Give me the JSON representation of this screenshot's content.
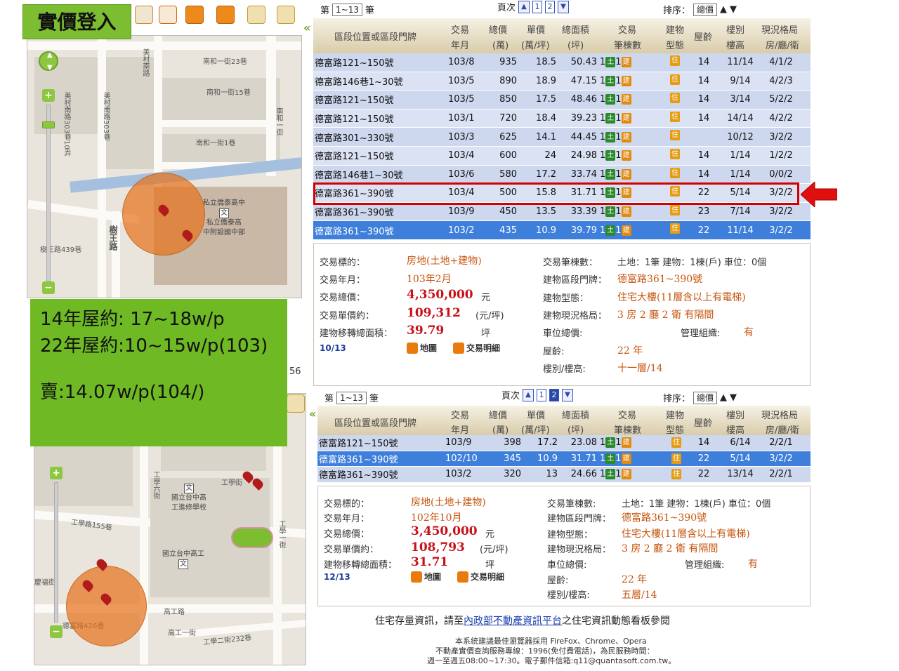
{
  "title": "實價登入",
  "note": {
    "line1": "14年屋約: 17~18w/p",
    "line2": "22年屋約:10~15w/p(103)",
    "line3": "賣:14.07w/p(104/)"
  },
  "colors": {
    "accent_green": "#7cbd31",
    "selected_row": "#3d7fdb",
    "highlight": "#d40000",
    "price_red": "#c8101a"
  },
  "map_top": {
    "streets": [
      "南和一街23巷",
      "南和一街15巷",
      "南和一街1巷",
      "美村南路",
      "美村南路303巷",
      "南和一街",
      "樹王路",
      "樹王路439巷",
      "美村南路303巷10弄"
    ],
    "pois": [
      "私立僑泰高中",
      "私立僑泰高",
      "中附設國中部"
    ]
  },
  "map_bottom": {
    "streets": [
      "工學路155巷",
      "工學二街232巷",
      "工學街",
      "高工路",
      "高工一街",
      "德富路426巷",
      "慶福街",
      "工學六街",
      "工學一街"
    ],
    "pois": [
      "國立台中高",
      "工進修學校",
      "國立台中高工"
    ],
    "scale_partial": "56"
  },
  "top": {
    "pager": {
      "range_label": "第",
      "range": "1~13",
      "unit": "筆",
      "page_label": "頁次",
      "pages": [
        "1",
        "2"
      ]
    },
    "sort": {
      "label": "排序：",
      "value": "總價",
      "asc": "▲",
      "desc": "▼"
    },
    "headers": {
      "location": "區段位置或區段門牌",
      "date1": "交易",
      "date2": "年月",
      "total1": "總價",
      "total2": "(萬)",
      "unit1": "單價",
      "unit2": "(萬/坪)",
      "area1": "總面積",
      "area2": "(坪)",
      "count1": "交易",
      "count2": "筆棟數",
      "type1": "建物",
      "type2": "型態",
      "age": "屋齡",
      "floor1": "樓別",
      "floor2": "樓高",
      "layout1": "現況格局",
      "layout2": "房/廳/衛"
    },
    "rows": [
      {
        "addr": "德富路121~150號",
        "date": "103/8",
        "total": "935",
        "unit": "18.5",
        "area": "50.43",
        "age": "14",
        "floor": "11/14",
        "layout": "4/1/2"
      },
      {
        "addr": "德富路146巷1~30號",
        "date": "103/5",
        "total": "890",
        "unit": "18.9",
        "area": "47.15",
        "age": "14",
        "floor": "9/14",
        "layout": "4/2/3"
      },
      {
        "addr": "德富路121~150號",
        "date": "103/5",
        "total": "850",
        "unit": "17.5",
        "area": "48.46",
        "age": "14",
        "floor": "3/14",
        "layout": "5/2/2"
      },
      {
        "addr": "德富路121~150號",
        "date": "103/1",
        "total": "720",
        "unit": "18.4",
        "area": "39.23",
        "age": "14",
        "floor": "14/14",
        "layout": "4/2/2"
      },
      {
        "addr": "德富路301~330號",
        "date": "103/3",
        "total": "625",
        "unit": "14.1",
        "area": "44.45",
        "age": "",
        "floor": "10/12",
        "layout": "3/2/2"
      },
      {
        "addr": "德富路121~150號",
        "date": "103/4",
        "total": "600",
        "unit": "24",
        "area": "24.98",
        "age": "14",
        "floor": "1/14",
        "layout": "1/2/2"
      },
      {
        "addr": "德富路146巷1~30號",
        "date": "103/6",
        "total": "580",
        "unit": "17.2",
        "area": "33.74",
        "age": "14",
        "floor": "1/14",
        "layout": "0/0/2"
      },
      {
        "addr": "德富路361~390號",
        "date": "103/4",
        "total": "500",
        "unit": "15.8",
        "area": "31.71",
        "age": "22",
        "floor": "5/14",
        "layout": "3/2/2"
      },
      {
        "addr": "德富路361~390號",
        "date": "103/9",
        "total": "450",
        "unit": "13.5",
        "area": "33.39",
        "age": "23",
        "floor": "7/14",
        "layout": "3/2/2"
      },
      {
        "addr": "德富路361~390號",
        "date": "103/2",
        "total": "435",
        "unit": "10.9",
        "area": "39.79",
        "age": "22",
        "floor": "11/14",
        "layout": "3/2/2"
      }
    ],
    "badges": {
      "count": "1",
      "land": "土",
      "bldg": "建",
      "type": "住"
    },
    "detail": {
      "l_target": "交易標的：",
      "v_target": "房地(土地+建物)",
      "l_date": "交易年月：",
      "v_date": "103年2月",
      "l_total": "交易總價：",
      "v_total": "4,350,000",
      "u_total": "元",
      "l_unit": "交易單價約：",
      "v_unit": "109,312",
      "u_unit": "(元/坪)",
      "l_area": "建物移轉總面積：",
      "v_area": "39.79",
      "u_area": "坪",
      "page": "10/13",
      "link_map": "地圖",
      "link_detail": "交易明細",
      "l_count": "交易筆棟數：",
      "v_count": "土地：1筆 建物：1棟(戶) 車位：0個",
      "l_addr": "建物區段門牌：",
      "v_addr": "德富路361~390號",
      "l_type": "建物型態：",
      "v_type": "住宅大樓(11層含以上有電梯)",
      "l_layout": "建物現況格局：",
      "v_layout": "3 房 2 廳 2 衛 有隔間",
      "l_park": "車位總價:",
      "l_mgmt": "管理組織:",
      "v_mgmt": "有",
      "l_age": "屋齡:",
      "v_age": "22 年",
      "l_floor": "樓別/樓高:",
      "v_floor": "十一層/14"
    }
  },
  "bottom": {
    "pager": {
      "range_label": "第",
      "range": "1~13",
      "unit": "筆",
      "page_label": "頁次",
      "pages": [
        "1",
        "2"
      ]
    },
    "sort": {
      "label": "排序：",
      "value": "總價",
      "asc": "▲",
      "desc": "▼"
    },
    "rows": [
      {
        "addr": "德富路121~150號",
        "date": "103/9",
        "total": "398",
        "unit": "17.2",
        "area": "23.08",
        "age": "14",
        "floor": "6/14",
        "layout": "2/2/1"
      },
      {
        "addr": "德富路361~390號",
        "date": "102/10",
        "total": "345",
        "unit": "10.9",
        "area": "31.71",
        "age": "22",
        "floor": "5/14",
        "layout": "3/2/2"
      },
      {
        "addr": "德富路361~390號",
        "date": "103/2",
        "total": "320",
        "unit": "13",
        "area": "24.66",
        "age": "22",
        "floor": "13/14",
        "layout": "2/2/1"
      }
    ],
    "detail": {
      "l_target": "交易標的：",
      "v_target": "房地(土地+建物)",
      "l_date": "交易年月：",
      "v_date": "102年10月",
      "l_total": "交易總價：",
      "v_total": "3,450,000",
      "u_total": "元",
      "l_unit": "交易單價約：",
      "v_unit": "108,793",
      "u_unit": "(元/坪)",
      "l_area": "建物移轉總面積：",
      "v_area": "31.71",
      "u_area": "坪",
      "page": "12/13",
      "link_map": "地圖",
      "link_detail": "交易明細",
      "l_count": "交易筆棟數:",
      "v_count": "土地：1筆 建物：1棟(戶) 車位：0個",
      "l_addr": "建物區段門牌：",
      "v_addr": "德富路361~390號",
      "l_type": "建物型態：",
      "v_type": "住宅大樓(11層含以上有電梯)",
      "l_layout": "建物現況格局：",
      "v_layout": "3 房 2 廳 2 衛 有隔間",
      "l_park": "車位總價:",
      "l_mgmt": "管理組織:",
      "v_mgmt": "有",
      "l_age": "屋齡:",
      "v_age": "22 年",
      "l_floor": "樓別/樓高:",
      "v_floor": "五層/14"
    }
  },
  "footer": {
    "pre": "住宅存量資訊，請至",
    "link": "內政部不動產資訊平台",
    "post": "之住宅資訊動態看板參閱",
    "line1": "本系統建議最佳瀏覽器採用 FireFox、Chrome、Opera",
    "line2": "不動產實價查詢服務專線：1996(免付費電話)，為民服務時間：",
    "line3": "週一至週五08:00~17:30。電子郵件信箱:q11@quantasoft.com.tw。"
  }
}
